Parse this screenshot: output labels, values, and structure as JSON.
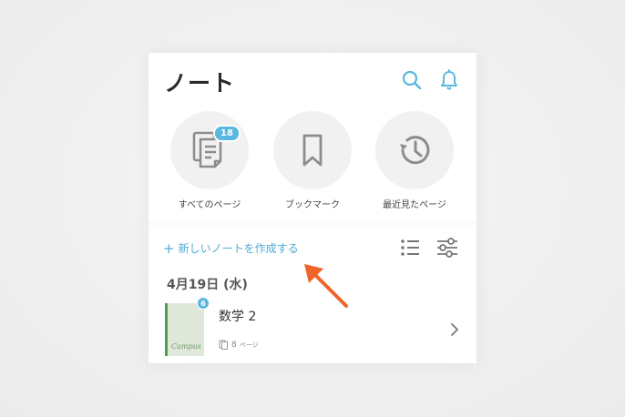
{
  "header": {
    "title": "ノート"
  },
  "shortcuts": [
    {
      "label": "すべてのページ",
      "badge": "18"
    },
    {
      "label": "ブックマーク"
    },
    {
      "label": "最近見たページ"
    }
  ],
  "toolbar": {
    "create_label": "新しいノートを作成する",
    "create_plus": "+"
  },
  "section": {
    "date": "4月19日 (水)"
  },
  "notes": [
    {
      "title": "数学 2",
      "badge": "6",
      "cover_label": "Campus",
      "page_count": "8",
      "page_unit": "ページ"
    }
  ],
  "colors": {
    "accent": "#5ab8e0",
    "link": "#4fa9d4",
    "annotation_arrow": "#f0642a"
  }
}
